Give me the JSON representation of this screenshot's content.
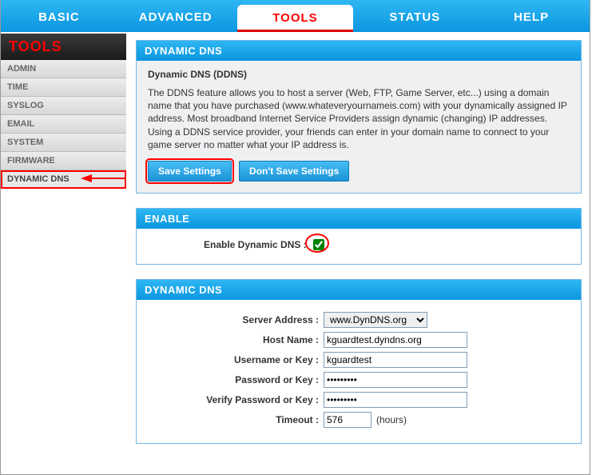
{
  "topnav": {
    "tabs": [
      {
        "label": "BASIC"
      },
      {
        "label": "ADVANCED"
      },
      {
        "label": "TOOLS"
      },
      {
        "label": "STATUS"
      },
      {
        "label": "HELP"
      }
    ],
    "active": 2
  },
  "sidebar": {
    "title": "TOOLS",
    "items": [
      {
        "label": "ADMIN"
      },
      {
        "label": "TIME"
      },
      {
        "label": "SYSLOG"
      },
      {
        "label": "EMAIL"
      },
      {
        "label": "SYSTEM"
      },
      {
        "label": "FIRMWARE"
      },
      {
        "label": "DYNAMIC DNS"
      }
    ],
    "active": 6
  },
  "intro": {
    "heading": "DYNAMIC DNS",
    "subhead": "Dynamic DNS (DDNS)",
    "desc": "The DDNS feature allows you to host a server (Web, FTP, Game Server, etc...) using a domain name that you have purchased (www.whateveryournameis.com) with your dynamically assigned IP address. Most broadband Internet Service Providers assign dynamic (changing) IP addresses. Using a DDNS service provider, your friends can enter in your domain name to connect to your game server no matter what your IP address is.",
    "save_label": "Save Settings",
    "dontsave_label": "Don't Save Settings"
  },
  "enable": {
    "heading": "ENABLE",
    "label": "Enable Dynamic DNS :",
    "checked": true
  },
  "ddns": {
    "heading": "DYNAMIC DNS",
    "server_label": "Server Address :",
    "server_value": "www.DynDNS.org",
    "host_label": "Host Name :",
    "host_value": "kguardtest.dyndns.org",
    "user_label": "Username or Key :",
    "user_value": "kguardtest",
    "pass_label": "Password or Key :",
    "pass_value": "•••••••••",
    "vpass_label": "Verify Password or Key :",
    "vpass_value": "•••••••••",
    "timeout_label": "Timeout :",
    "timeout_value": "576",
    "timeout_suffix": "(hours)"
  }
}
